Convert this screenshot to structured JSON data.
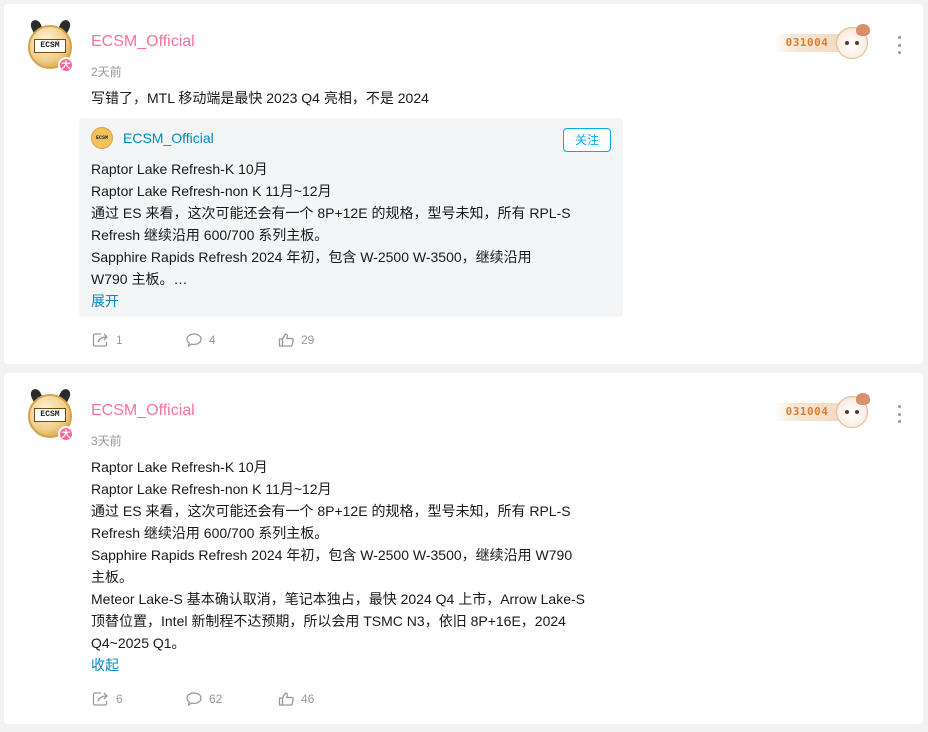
{
  "colors": {
    "username": "#fb7299",
    "link": "#008ac5",
    "follow": "#00aeec",
    "meta": "#9499a0"
  },
  "posts": [
    {
      "author": "ECSM_Official",
      "avatar_text": "ECSM",
      "avatar_badge": "大",
      "time": "2天前",
      "decor_number": "031004",
      "text": "写错了，MTL 移动端是最快 2023 Q4 亮相，不是 2024",
      "quote": {
        "author": "ECSM_Official",
        "avatar_text": "ECSM",
        "follow_label": "关注",
        "lines": [
          "Raptor Lake Refresh-K 10月",
          "Raptor Lake Refresh-non K 11月~12月",
          "通过 ES 来看，这次可能还会有一个 8P+12E 的规格，型号未知，所有 RPL-S",
          "Refresh 继续沿用 600/700 系列主板。",
          "Sapphire Rapids Refresh 2024 年初，包含 W-2500 W-3500，继续沿用",
          "W790 主板。…"
        ],
        "expand_label": "展开"
      },
      "actions": {
        "forward_icon": "share-icon",
        "forward": "1",
        "comment_icon": "comment-icon",
        "comment": "4",
        "like_icon": "thumbs-up-icon",
        "like": "29"
      }
    },
    {
      "author": "ECSM_Official",
      "avatar_text": "ECSM",
      "avatar_badge": "大",
      "time": "3天前",
      "decor_number": "031004",
      "lines": [
        "Raptor Lake Refresh-K 10月",
        "Raptor Lake Refresh-non K 11月~12月",
        "通过 ES 来看，这次可能还会有一个 8P+12E 的规格，型号未知，所有 RPL-S",
        "Refresh 继续沿用 600/700 系列主板。",
        "Sapphire Rapids Refresh 2024 年初，包含 W-2500 W-3500，继续沿用 W790",
        "主板。",
        "Meteor Lake-S 基本确认取消，笔记本独占，最快 2024 Q4 上市，Arrow Lake-S",
        "顶替位置，Intel 新制程不达预期，所以会用 TSMC N3，依旧 8P+16E，2024",
        "Q4~2025 Q1。"
      ],
      "collapse_label": "收起",
      "actions": {
        "forward_icon": "share-icon",
        "forward": "6",
        "comment_icon": "comment-icon",
        "comment": "62",
        "like_icon": "thumbs-up-icon",
        "like": "46"
      }
    }
  ]
}
